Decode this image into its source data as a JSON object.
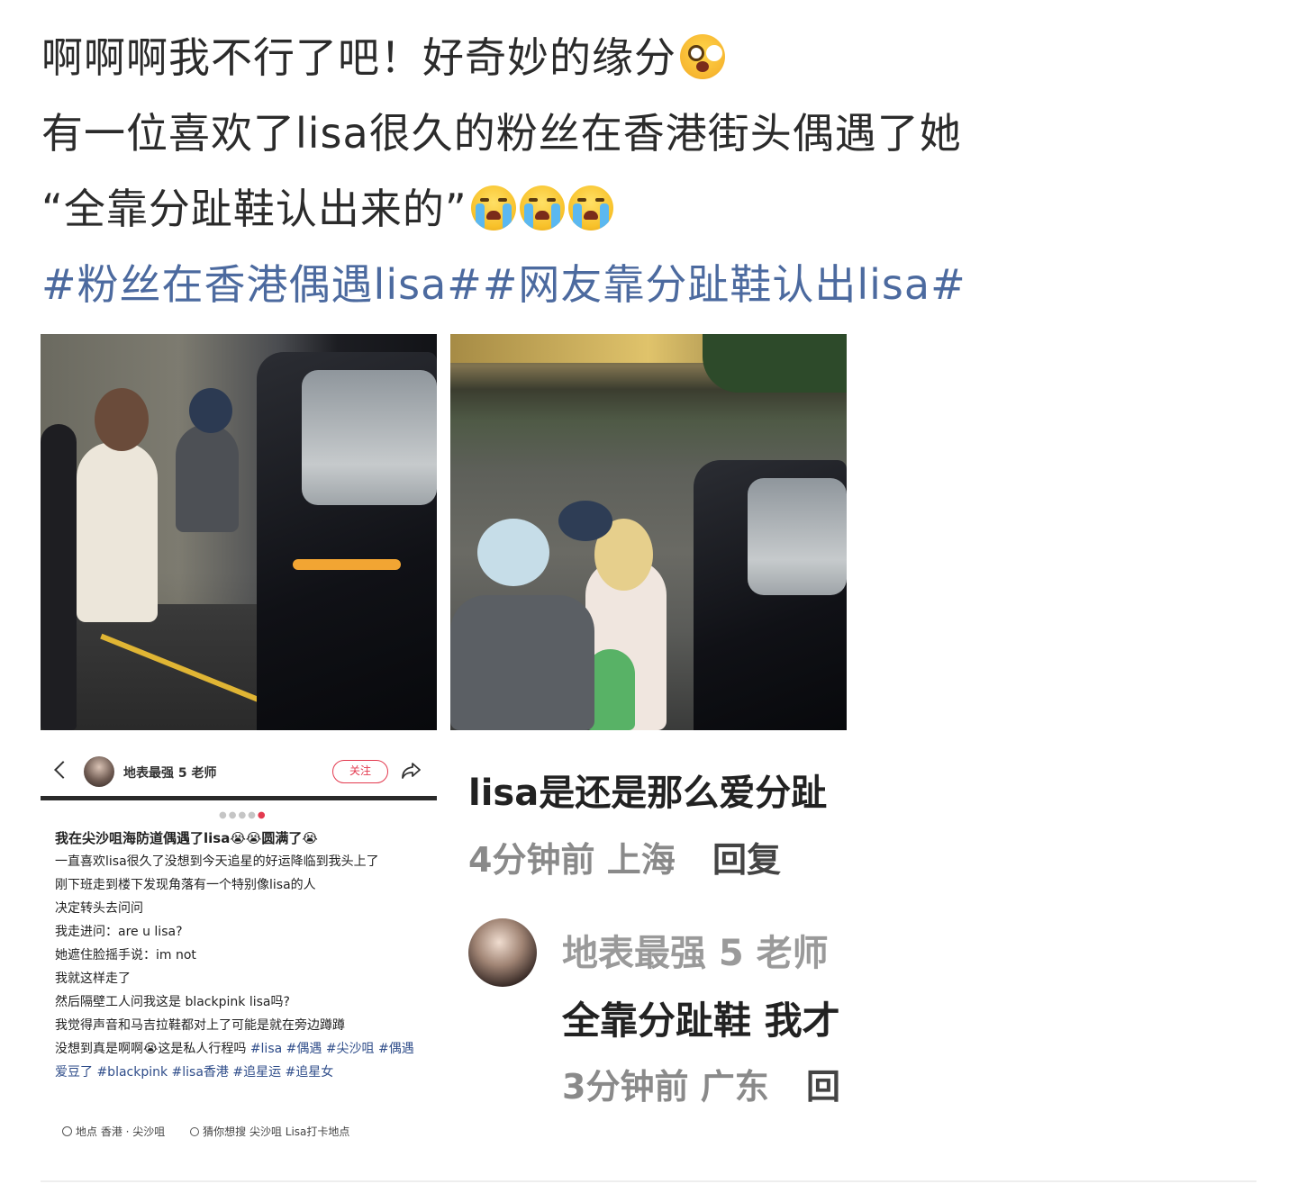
{
  "post": {
    "line1": "啊啊啊我不行了吧！好奇妙的缘分",
    "line2": "有一位喜欢了lisa很久的粉丝在香港街头偶遇了她",
    "line3": "“全靠分趾鞋认出来的”",
    "hashtag1": "#粉丝在香港偶遇lisa#",
    "hashtag2": "#网友靠分趾鞋认出lisa#",
    "hashtag_color": "#4c6a9f"
  },
  "card": {
    "author": "地表最强 5 老师",
    "follow_label": "关注",
    "title": "我在尖沙咀海防道偶遇了lisa😭😭圆满了😭",
    "body_lines": [
      "一直喜欢lisa很久了没想到今天追星的好运降临到我头上了",
      "刚下班走到楼下发现角落有一个特别像lisa的人",
      "决定转头去问问",
      "我走进问：are u lisa?",
      "她遮住脸摇手说：im not",
      "我就这样走了",
      "然后隔壁工人问我这是 blackpink lisa吗?",
      "我觉得声音和马吉拉鞋都对上了可能是就在旁边蹲蹲",
      "没想到真是啊啊😭这是私人行程吗"
    ],
    "tags": "#lisa #偶遇 #尖沙咀 #偶遇爱豆了 #blackpink #lisa香港 #追星运 #追星女",
    "location_label": "地点",
    "location_value": "香港 · 尖沙咀",
    "search_label": "猜你想搜",
    "search_value": "尖沙咀 Lisa打卡地点",
    "accent": "#e33a4f"
  },
  "comments": {
    "c1_text": "lisa是还是那么爱分趾",
    "c1_time": "4分钟前",
    "c1_loc": "上海",
    "reply_label": "回复",
    "c2_author": "地表最强 5 老师",
    "c2_text": "全靠分趾鞋 我才",
    "c2_time": "3分钟前",
    "c2_loc": "广东",
    "c2_reply": "回"
  }
}
